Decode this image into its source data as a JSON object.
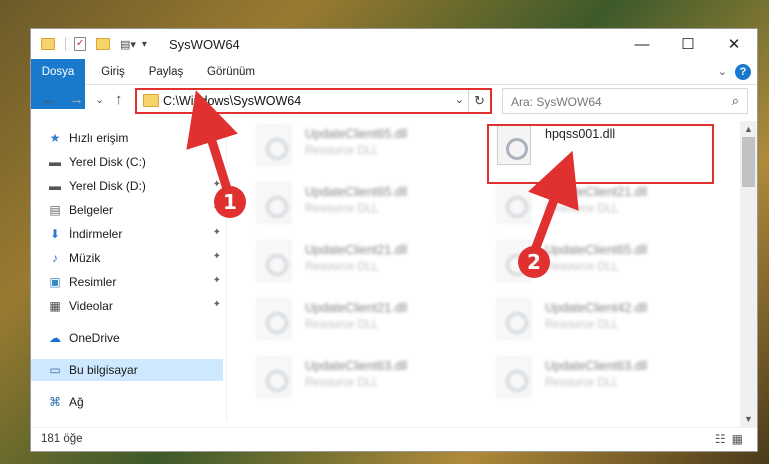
{
  "window": {
    "title": "SysWOW64",
    "minimize": "—",
    "maximize": "☐",
    "close": "✕"
  },
  "ribbon": {
    "tabs": [
      "Dosya",
      "Giriş",
      "Paylaş",
      "Görünüm"
    ],
    "help": "?",
    "collapse": "⌄"
  },
  "nav": {
    "back": "←",
    "forward": "→",
    "recent": "⌄",
    "up": "↑",
    "address_path": "C:\\Windows\\SysWOW64",
    "address_dropdown": "⌄",
    "refresh": "↻",
    "search_placeholder": "Ara: SysWOW64",
    "search_icon": "⌕"
  },
  "sidebar": {
    "items": [
      {
        "label": "Hızlı erişim",
        "icon": "star-icon",
        "glyph": "★",
        "pinned": false
      },
      {
        "label": "Yerel Disk (C:)",
        "icon": "drive-icon",
        "glyph": "▬",
        "pinned": true
      },
      {
        "label": "Yerel Disk (D:)",
        "icon": "drive-icon",
        "glyph": "▬",
        "pinned": true
      },
      {
        "label": "Belgeler",
        "icon": "document-icon",
        "glyph": "▤",
        "pinned": true
      },
      {
        "label": "İndirmeler",
        "icon": "download-icon",
        "glyph": "⬇",
        "pinned": true
      },
      {
        "label": "Müzik",
        "icon": "music-icon",
        "glyph": "♪",
        "pinned": true
      },
      {
        "label": "Resimler",
        "icon": "pictures-icon",
        "glyph": "▣",
        "pinned": true
      },
      {
        "label": "Videolar",
        "icon": "video-icon",
        "glyph": "▦",
        "pinned": true
      },
      {
        "label": "OneDrive",
        "icon": "cloud-icon",
        "glyph": "☁",
        "pinned": false
      },
      {
        "label": "Bu bilgisayar",
        "icon": "computer-icon",
        "glyph": "▭",
        "pinned": false
      },
      {
        "label": "Ağ",
        "icon": "network-icon",
        "glyph": "⌘",
        "pinned": false
      }
    ],
    "pin_glyph": "📌"
  },
  "files": [
    {
      "name": "UpdateClient65.dll",
      "type": "Resource DLL",
      "blurred": true
    },
    {
      "name": "hpqss001.dll",
      "type": "",
      "blurred": false
    },
    {
      "name": "UpdateClient65.dll",
      "type": "Resource DLL",
      "blurred": true
    },
    {
      "name": "UpdateClient21.dll",
      "type": "Resource DLL",
      "blurred": true
    },
    {
      "name": "UpdateClient21.dll",
      "type": "Resource DLL",
      "blurred": true
    },
    {
      "name": "UpdateClient65.dll",
      "type": "Resource DLL",
      "blurred": true
    },
    {
      "name": "UpdateClient21.dll",
      "type": "Resource DLL",
      "blurred": true
    },
    {
      "name": "UpdateClient42.dll",
      "type": "Resource DLL",
      "blurred": true
    },
    {
      "name": "UpdateClient63.dll",
      "type": "Resource DLL",
      "blurred": true
    },
    {
      "name": "UpdateClient63.dll",
      "type": "Resource DLL",
      "blurred": true
    }
  ],
  "status": {
    "item_count": "181 öğe",
    "view_icons": "☷▦"
  },
  "annotations": {
    "step1": "1",
    "step2": "2",
    "color": "#e03030"
  },
  "colors": {
    "accent": "#1979ca",
    "selection": "#cde8ff"
  }
}
